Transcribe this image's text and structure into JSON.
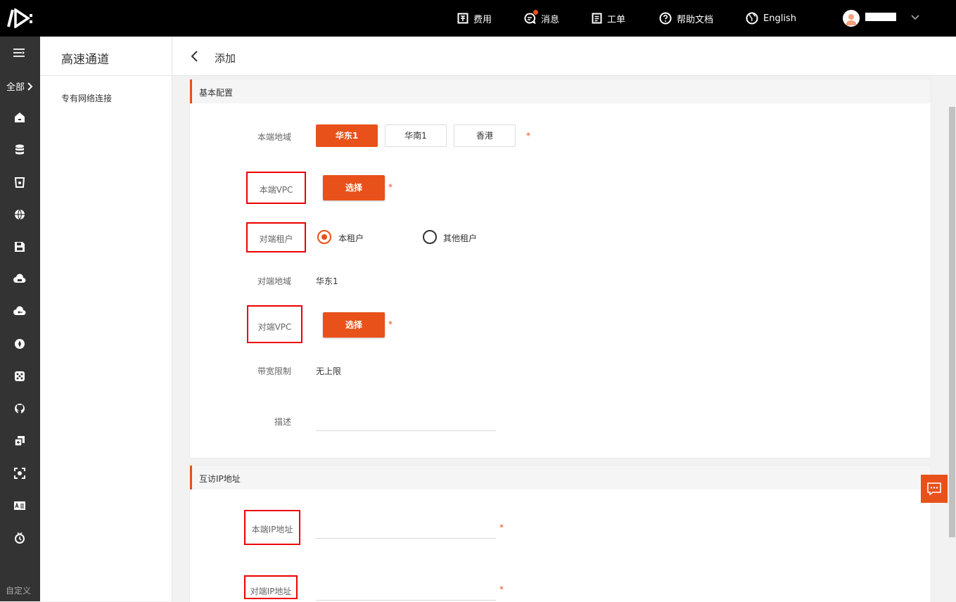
{
  "topbar": {
    "items": [
      {
        "label": "费用"
      },
      {
        "label": "消息"
      },
      {
        "label": "工单"
      },
      {
        "label": "帮助文档"
      },
      {
        "label": "English"
      }
    ]
  },
  "rail": {
    "all_label": "全部",
    "custom_label": "自定义"
  },
  "sidebar": {
    "title": "高速通道",
    "items": [
      {
        "label": "专有网络连接"
      }
    ]
  },
  "header": {
    "title": "添加"
  },
  "basic": {
    "section_title": "基本配置",
    "local_region_label": "本端地域",
    "regions": [
      {
        "label": "华东1",
        "selected": true
      },
      {
        "label": "华南1"
      },
      {
        "label": "香港"
      }
    ],
    "local_vpc_label": "本端VPC",
    "select_label": "选择",
    "peer_tenant_label": "对端租户",
    "tenant_options": [
      {
        "label": "本租户",
        "selected": true
      },
      {
        "label": "其他租户"
      }
    ],
    "peer_region_label": "对端地域",
    "peer_region_value": "华东1",
    "peer_vpc_label": "对端VPC",
    "bandwidth_label": "带宽限制",
    "bandwidth_value": "无上限",
    "desc_label": "描述",
    "required_mark": "*"
  },
  "ip": {
    "section_title": "互访IP地址",
    "local_ip_label": "本端IP地址",
    "peer_ip_label": "对端IP地址"
  },
  "colors": {
    "accent": "#e8511a",
    "highlight_box": "#e00000",
    "topbar": "#000000",
    "rail": "#333333"
  }
}
